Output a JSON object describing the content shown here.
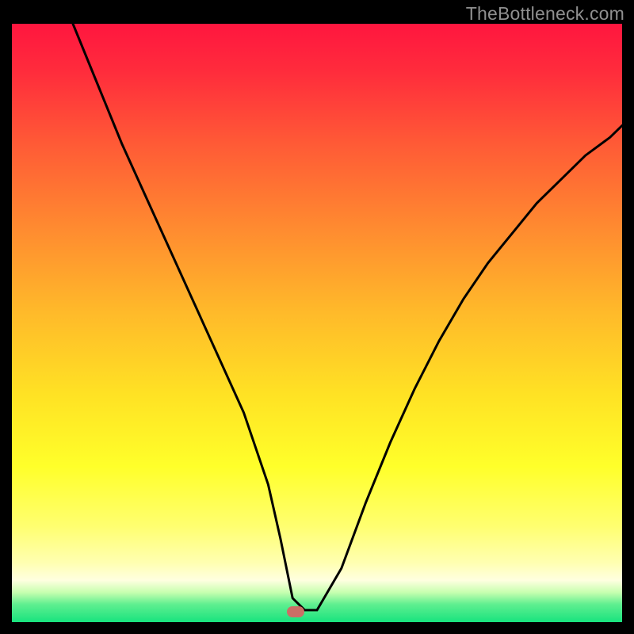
{
  "watermark": "TheBottleneck.com",
  "marker": {
    "x_pct": 46.5,
    "y_pct": 98.3
  },
  "chart_data": {
    "type": "line",
    "title": "",
    "xlabel": "",
    "ylabel": "",
    "xlim": [
      0,
      100
    ],
    "ylim": [
      0,
      100
    ],
    "series": [
      {
        "name": "bottleneck-curve",
        "x": [
          10,
          14,
          18,
          22,
          26,
          30,
          34,
          38,
          42,
          44,
          46,
          48,
          50,
          54,
          58,
          62,
          66,
          70,
          74,
          78,
          82,
          86,
          90,
          94,
          98,
          100
        ],
        "y_pct": [
          100,
          90,
          80,
          71,
          62,
          53,
          44,
          35,
          23,
          14,
          4,
          2,
          2,
          9,
          20,
          30,
          39,
          47,
          54,
          60,
          65,
          70,
          74,
          78,
          81,
          83
        ]
      }
    ],
    "annotations": [
      {
        "name": "min-marker",
        "x": 47,
        "y_pct": 1.5
      }
    ],
    "background": "red-yellow-green-vertical-gradient"
  }
}
